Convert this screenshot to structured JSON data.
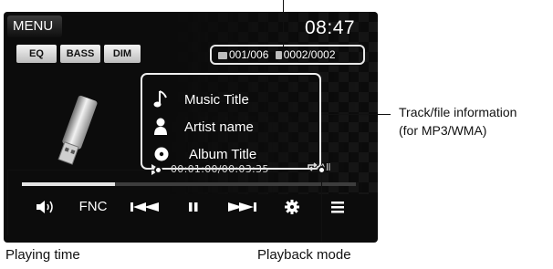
{
  "screen": {
    "menu_label": "MENU",
    "clock": "08:47",
    "buttons": {
      "eq": "EQ",
      "bass": "BASS",
      "dim": "DIM"
    },
    "folder": {
      "current": "001",
      "total": "006"
    },
    "file": {
      "current": "0002",
      "total": "0002"
    },
    "track": {
      "title": "Music Title",
      "artist": "Artist name",
      "album": "Album Title"
    },
    "time": "00:01:00/00:03:35",
    "repeat": "All",
    "progress": 0.28,
    "controls": {
      "fnc": "FNC"
    },
    "icons": [
      "volume-icon",
      "skip-back-icon",
      "pause-icon",
      "skip-forward-icon",
      "settings-icon",
      "list-icon"
    ]
  },
  "callouts": {
    "track_info": "Track/file information\n(for MP3/WMA)",
    "track_info_line1": "Track/file information",
    "track_info_line2": "(for MP3/WMA)",
    "playing_time": "Playing time",
    "playback_mode": "Playback mode"
  }
}
